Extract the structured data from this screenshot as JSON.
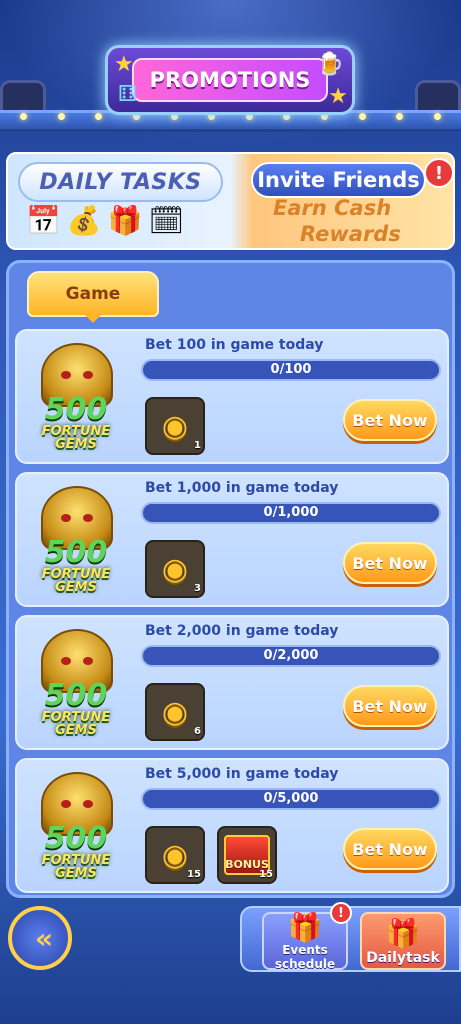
{
  "header": {
    "title": "PROMOTIONS"
  },
  "top_banner": {
    "daily_tasks_label": "DAILY TASKS",
    "invite_label": "Invite Friends",
    "alert_mark": "!",
    "earn_line": "Earn Cash",
    "rewards_line": "Rewards"
  },
  "tabs": [
    {
      "label": "Game",
      "selected": true
    }
  ],
  "game": {
    "thumb_number": "500",
    "thumb_name": "FORTUNE GEMS"
  },
  "tasks": [
    {
      "title": "Bet 100 in game today",
      "progress_text": "0/100",
      "progress": 0,
      "rewards": [
        {
          "type": "coins",
          "count": "1"
        }
      ],
      "button": "Bet Now"
    },
    {
      "title": "Bet 1,000 in game today",
      "progress_text": "0/1,000",
      "progress": 0,
      "rewards": [
        {
          "type": "coins",
          "count": "3"
        }
      ],
      "button": "Bet Now"
    },
    {
      "title": "Bet 2,000 in game today",
      "progress_text": "0/2,000",
      "progress": 0,
      "rewards": [
        {
          "type": "coins",
          "count": "6"
        }
      ],
      "button": "Bet Now"
    },
    {
      "title": "Bet 5,000 in game today",
      "progress_text": "0/5,000",
      "progress": 0,
      "rewards": [
        {
          "type": "coins",
          "count": "15"
        },
        {
          "type": "bonus",
          "label": "BONUS",
          "count": "15"
        }
      ],
      "button": "Bet Now"
    }
  ],
  "bottom_nav": {
    "back_icon": "double-chevron-left-icon",
    "events_label_line1": "Events",
    "events_label_line2": "schedule",
    "events_alert": "!",
    "daily_label": "Dailytask"
  },
  "colors": {
    "accent": "#ffb526",
    "panel": "#5f86e6",
    "progress_track": "#3754b8"
  }
}
